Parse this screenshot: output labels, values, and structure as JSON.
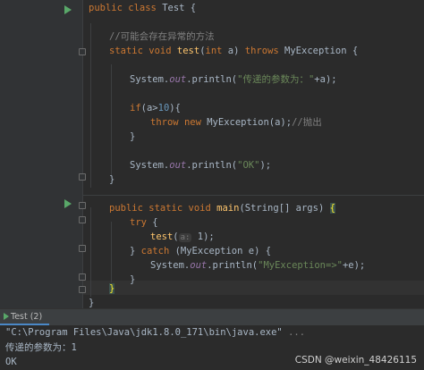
{
  "editor": {
    "lines": {
      "class_decl": [
        "public",
        "class",
        "Test {"
      ],
      "comment": "//可能会存在异常的方法",
      "method_decl": [
        "static",
        "void",
        "test",
        "(",
        "int",
        " a) ",
        "throws",
        " MyException {"
      ],
      "println1": [
        "System.",
        "out",
        ".println(",
        "\"传递的参数为：\"",
        "+a);"
      ],
      "if_stmt": [
        "if",
        "(a>",
        "10",
        "){"
      ],
      "throw_stmt": [
        "throw",
        "new",
        " MyException(a);",
        "//抛出"
      ],
      "close_if": "}",
      "println_ok": [
        "System.",
        "out",
        ".println(",
        "\"OK\"",
        ");"
      ],
      "close_method": "}",
      "main_decl": [
        "public",
        "static",
        "void",
        "main",
        "(String[] args) ",
        "{"
      ],
      "try_stmt": [
        "try",
        " {"
      ],
      "test_call": [
        "test",
        "(",
        "a:",
        " 1);"
      ],
      "catch_stmt": [
        "} ",
        "catch",
        " (MyException e) {"
      ],
      "println_catch": [
        "System.",
        "out",
        ".println(",
        "\"MyException=>\"",
        "+e);"
      ],
      "close_catch": "}",
      "close_main": "}",
      "close_class": "}"
    }
  },
  "console": {
    "tab_label": "Test (2)",
    "command": "\"C:\\Program Files\\Java\\jdk1.8.0_171\\bin\\java.exe\"",
    "ellipsis": "...",
    "output_line1": "传递的参数为：1",
    "output_line2": "OK"
  },
  "watermark": "CSDN @weixin_48426115",
  "colors": {
    "background": "#2b2b2b",
    "keyword": "#cc7832",
    "function": "#ffc66d",
    "string": "#6a8759",
    "number": "#6897bb",
    "comment": "#808080",
    "run_icon": "#59a869"
  },
  "icons": [
    "run-gutter-icon",
    "fold-marker-icon",
    "run-tab-icon"
  ]
}
